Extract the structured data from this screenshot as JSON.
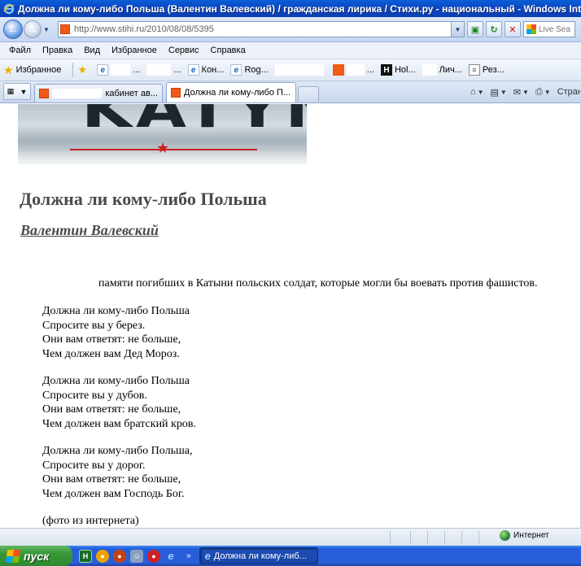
{
  "window": {
    "title": "Должна ли кому-либо Польша (Валентин Валевский) / гражданская лирика / Стихи.ру - национальный  - Windows Inter"
  },
  "address_bar": {
    "url": "http://www.stihi.ru/2010/08/08/5395",
    "search_placeholder": "Live Sea"
  },
  "menu": {
    "items": [
      "Файл",
      "Правка",
      "Вид",
      "Избранное",
      "Сервис",
      "Справка"
    ]
  },
  "favorites_bar": {
    "label": "Избранное",
    "items": [
      {
        "label": "...",
        "icon": "ie-icon"
      },
      {
        "label": "...",
        "icon": "blank"
      },
      {
        "label": "Кон...",
        "icon": "ie-icon"
      },
      {
        "label": "Rog...",
        "icon": "ie-icon"
      },
      {
        "label": "",
        "icon": "blank"
      },
      {
        "label": "...",
        "icon": "orange-square-icon"
      },
      {
        "label": "Hol...",
        "icon": "h-icon"
      },
      {
        "label": "Лич...",
        "icon": "blank"
      },
      {
        "label": "Рез...",
        "icon": "document-icon"
      }
    ]
  },
  "tabs": {
    "items": [
      {
        "label": "кабинет ав...",
        "active": false
      },
      {
        "label": "Должна ли кому-либо П...",
        "active": true
      }
    ]
  },
  "command_bar": {
    "page_label": "Стран"
  },
  "page": {
    "image_text": "KATYN",
    "title": "Должна ли кому-либо Польша",
    "author": "Валентин Валевский",
    "dedication": "памяти погибших в Катыни польских солдат, которые могли бы воевать против фашистов.",
    "stanzas": [
      [
        "Должна ли кому-либо Польша",
        "Спросите вы у берез.",
        "Они вам ответят: не больше,",
        "Чем должен вам Дед Мороз."
      ],
      [
        "Должна ли кому-либо Польша",
        "Спросите вы у дубов.",
        "Они вам ответят: не больше,",
        "Чем должен вам братский кров."
      ],
      [
        "Должна ли кому-либо Польша,",
        "Спросите вы у дорог.",
        "Они вам ответят: не больше,",
        "Чем должен вам Господь Бог."
      ]
    ],
    "photo_note": "(фото из интернета)"
  },
  "status_bar": {
    "zone": "Интернет"
  },
  "taskbar": {
    "start_label": "пуск",
    "quicklaunch_more": "»",
    "task_label": "Должна ли кому-либ..."
  }
}
